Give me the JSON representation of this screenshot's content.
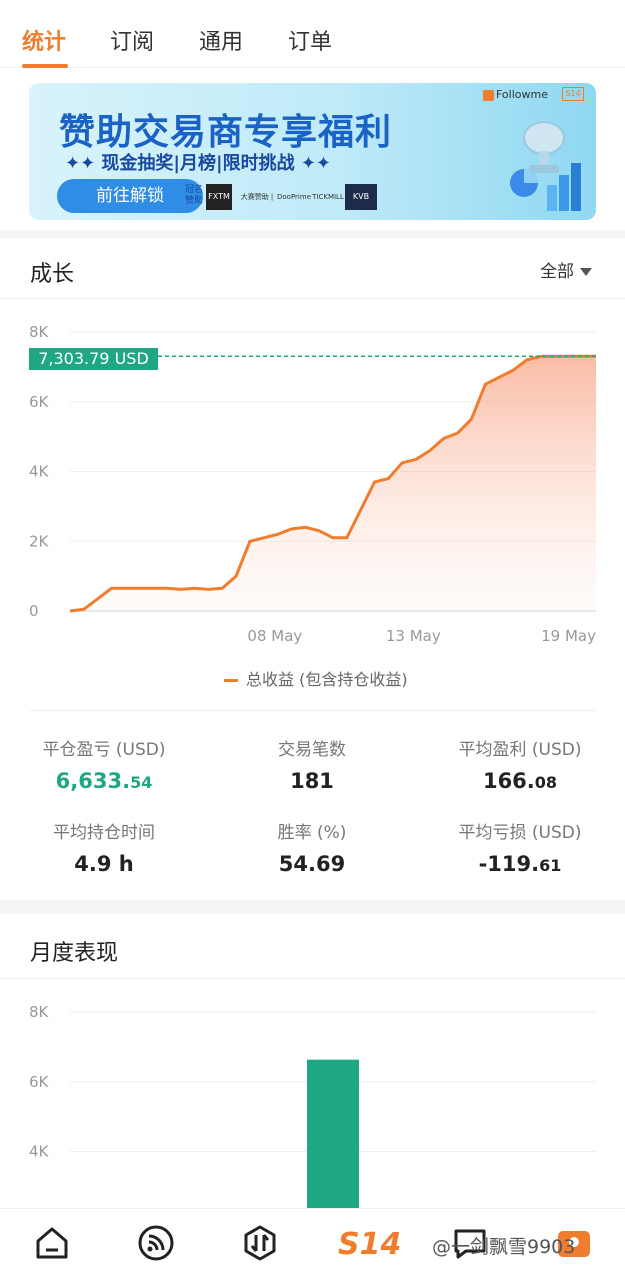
{
  "tabs": [
    {
      "label": "统计",
      "active": true
    },
    {
      "label": "订阅",
      "active": false
    },
    {
      "label": "通用",
      "active": false
    },
    {
      "label": "订单",
      "active": false
    }
  ],
  "banner": {
    "title": "赞助交易商专享福利",
    "subtitle": "✦✦ 现金抽奖|月榜|限时挑战 ✦✦",
    "button": "前往解锁",
    "sponsor_label": "冠名赞助",
    "brand": "Followme",
    "brand_badge": "S14",
    "logos": [
      "FXTM",
      "大赛赞助 |",
      "DooPrime",
      "TICKMILL",
      "KVB"
    ]
  },
  "growth": {
    "title": "成长",
    "filter": "全部",
    "current_value": "7,303.79 USD",
    "legend": "总收益 (包含持仓收益)"
  },
  "chart_data": {
    "type": "area",
    "title": "",
    "xlabel": "",
    "ylabel": "",
    "ylim": [
      0,
      8000
    ],
    "yticks": [
      "8K",
      "6K",
      "4K",
      "2K",
      "0"
    ],
    "xticks": [
      "08 May",
      "13 May",
      "19 May"
    ],
    "series": [
      {
        "name": "总收益 (包含持仓收益)",
        "color": "#f07c2e",
        "x": [
          0,
          0.5,
          1,
          1.5,
          2,
          2.5,
          3,
          3.5,
          4,
          4.5,
          5,
          5.5,
          6,
          6.5,
          7,
          7.5,
          8,
          8.5,
          9,
          9.5,
          10,
          10.5,
          11,
          11.5,
          12,
          12.5,
          13,
          13.5,
          14,
          14.5,
          15,
          15.5,
          16,
          16.5,
          17,
          17.5,
          18,
          18.5,
          19
        ],
        "values": [
          0,
          50,
          350,
          650,
          650,
          650,
          650,
          650,
          620,
          650,
          620,
          650,
          1000,
          2000,
          2100,
          2200,
          2350,
          2400,
          2300,
          2100,
          2100,
          2900,
          3700,
          3800,
          4250,
          4350,
          4600,
          4950,
          5100,
          5500,
          6500,
          6700,
          6900,
          7200,
          7300,
          7300,
          7303.79,
          7303.79,
          7303.79
        ]
      }
    ],
    "reference_value": 7303.79
  },
  "stats": [
    {
      "label": "平仓盈亏 (USD)",
      "int": "6,633.",
      "dec": "54",
      "green": true
    },
    {
      "label": "交易笔数",
      "int": "181",
      "dec": "",
      "green": false
    },
    {
      "label": "平均盈利 (USD)",
      "int": "166.",
      "dec": "08",
      "green": false
    },
    {
      "label": "平均持仓时间",
      "int": "4.9 h",
      "dec": "",
      "green": false
    },
    {
      "label": "胜率 (%)",
      "int": "54.69",
      "dec": "",
      "green": false
    },
    {
      "label": "平均亏损 (USD)",
      "int": "-119.",
      "dec": "61",
      "green": false
    }
  ],
  "monthly": {
    "title": "月度表现",
    "yticks": [
      "8K",
      "6K",
      "4K"
    ],
    "bar_value": 6633.54,
    "ylim": [
      0,
      8000
    ]
  },
  "bottom_nav": {
    "s14_label": "S14",
    "watermark": "@一剑飘雪9903"
  },
  "colors": {
    "accent": "#f07c2e",
    "green": "#1fa784",
    "banner_blue": "#1a63c4"
  }
}
